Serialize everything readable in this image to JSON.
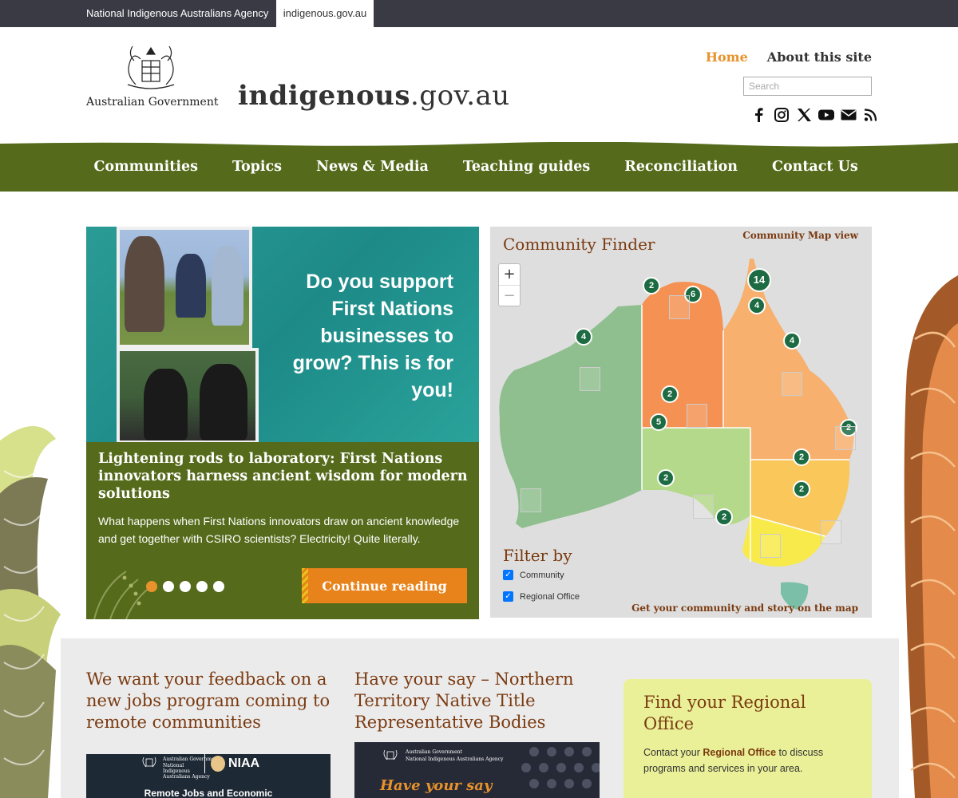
{
  "topbar": {
    "agency": "National Indigenous Australians Agency",
    "site": "indigenous.gov.au"
  },
  "header": {
    "gov_label": "Australian Government",
    "logo_bold": "indigenous",
    "logo_light": ".gov.au",
    "utility": {
      "home": "Home",
      "about": "About this site"
    },
    "search_placeholder": "Search",
    "social": [
      "facebook-icon",
      "instagram-icon",
      "x-icon",
      "youtube-icon",
      "email-icon",
      "rss-icon"
    ]
  },
  "nav": [
    "Communities",
    "Topics",
    "News & Media",
    "Teaching guides",
    "Reconciliation",
    "Contact Us"
  ],
  "hero": {
    "tagline": "Do you support First Nations businesses to grow? This is for you!",
    "title": "Lightening rods to laboratory: First Nations innovators harness ancient wisdom for modern solutions",
    "description": "What happens when First Nations innovators draw on ancient knowledge and get together with CSIRO scientists? Electricity! Quite literally.",
    "slides": 5,
    "active_slide": 1,
    "button": "Continue reading"
  },
  "finder": {
    "title": "Community Finder",
    "map_link": "Community Map view",
    "zoom_in": "+",
    "zoom_out": "−",
    "markers": [
      "2",
      "6",
      "14",
      "4",
      "4",
      "4",
      "2",
      "5",
      "2",
      "2",
      "2",
      "2",
      "2"
    ],
    "filter_title": "Filter by",
    "filters": [
      {
        "label": "Community",
        "checked": true
      },
      {
        "label": "Regional Office",
        "checked": true
      }
    ],
    "bottom_link": "Get your community and story on the map"
  },
  "lower": {
    "card1_title": "We want your feedback on a new jobs program coming to remote communities",
    "card1_img_text": "Remote Jobs and Economic",
    "card1_niaa": "NIAA",
    "card1_gov": "Australian Government",
    "card1_agency": "National Indigenous Australians Agency",
    "card2_title": "Have your say – Northern Territory Native Title Representative Bodies",
    "card2_gov": "Australian Government",
    "card2_agency": "National Indigenous Australians Agency",
    "card2_img_text": "Have your say",
    "regional_title": "Find your Regional Office",
    "regional_pre": "Contact your ",
    "regional_link": "Regional Office",
    "regional_post": " to discuss programs and services in your area."
  },
  "colors": {
    "nav_green": "#556b1b",
    "accent_orange": "#e8922b",
    "heading_brown": "#7a3a10",
    "topbar": "#3a3a45"
  }
}
